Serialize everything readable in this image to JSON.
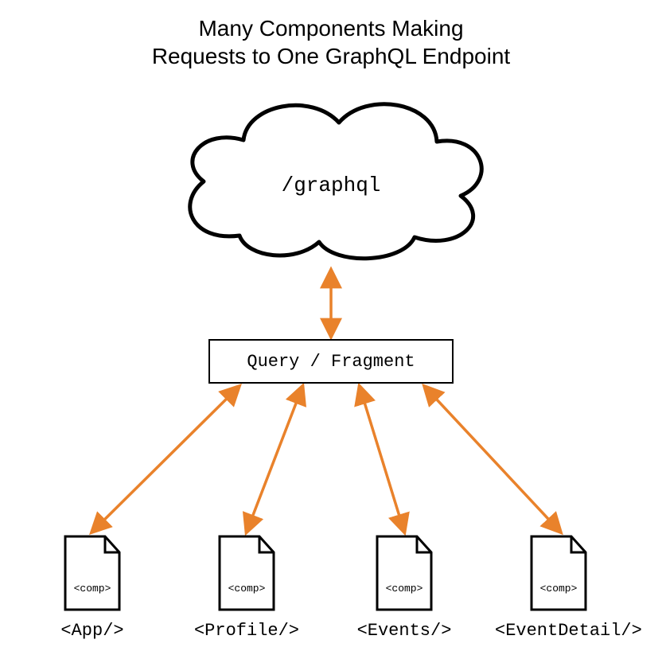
{
  "title_line1": "Many Components Making",
  "title_line2": "Requests to One GraphQL Endpoint",
  "cloud_label": "/graphql",
  "query_box_label": "Query / Fragment",
  "file_inner_label": "<comp>",
  "components": [
    {
      "caption": "<App/>"
    },
    {
      "caption": "<Profile/>"
    },
    {
      "caption": "<Events/>"
    },
    {
      "caption": "<EventDetail/>"
    }
  ],
  "arrow_color": "#e9822b"
}
